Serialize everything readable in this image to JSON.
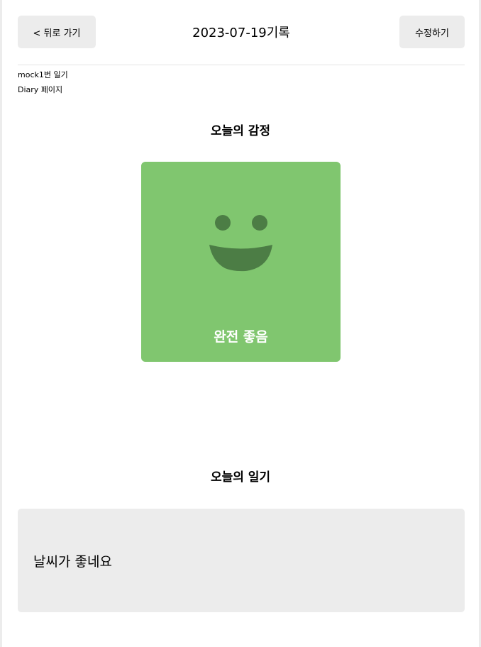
{
  "header": {
    "back_label": "< 뒤로 가기",
    "title": "2023-07-19기록",
    "edit_label": "수정하기"
  },
  "info": {
    "line1": "mock1번 일기",
    "line2": "Diary 페이지"
  },
  "emotion": {
    "section_title": "오늘의 감정",
    "label": "완전 좋음",
    "icon": "smile-icon",
    "color": "#80c66f",
    "face_color": "#4c7d45"
  },
  "diary": {
    "section_title": "오늘의 일기",
    "content": "날씨가 좋네요"
  }
}
